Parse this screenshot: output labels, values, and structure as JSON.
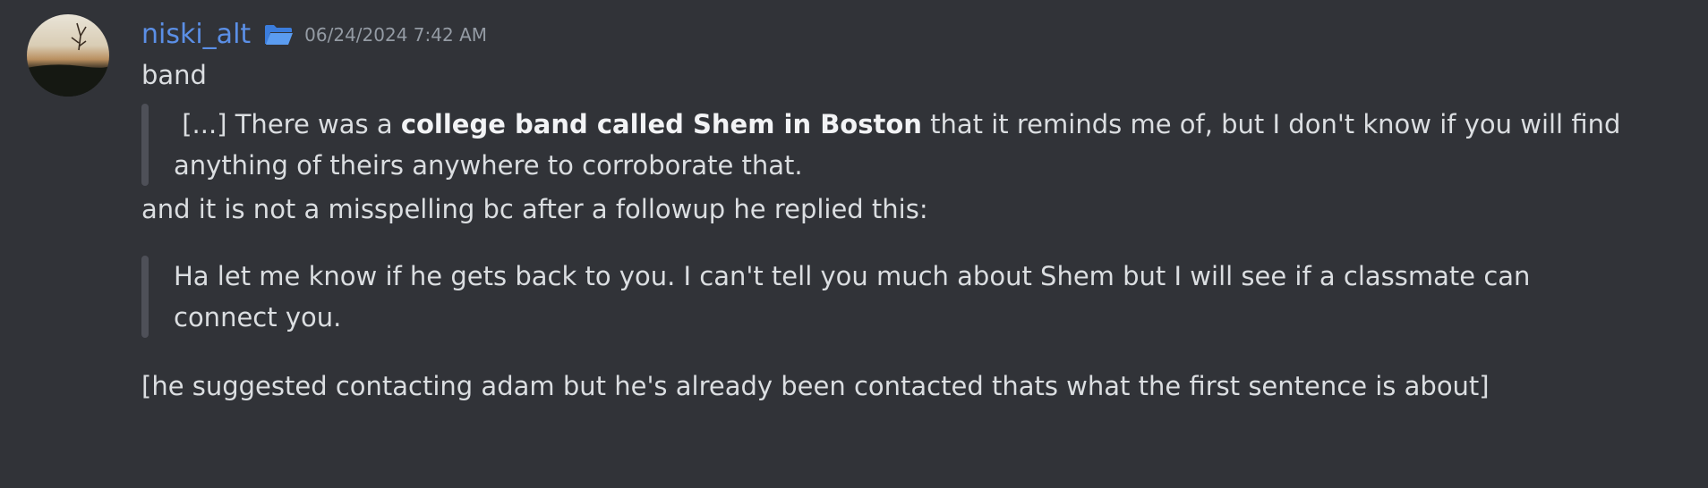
{
  "message": {
    "author": "niski_alt",
    "timestamp": "06/24/2024 7:42 AM",
    "icons": {
      "folder": "folder-icon",
      "avatar": "avatar-sunset-image"
    },
    "colors": {
      "username": "#5b8fe6",
      "text": "#dbdee1",
      "muted": "#949ba4",
      "background": "#313338",
      "quote_bar": "#4e5058"
    },
    "lines": {
      "first": "band",
      "quote1": {
        "line1_pre": "[...] There was a ",
        "line1_bold": "college band called Shem in Boston",
        "line1_post": " that it reminds me of, but I don't know if you will find",
        "line2": "anything of theirs anywhere to corroborate that."
      },
      "middle": "and it is not a misspelling bc after a followup he replied this:",
      "quote2": {
        "line1": "Ha let me know if he gets back to you. I can't tell you much about Shem but I will see if a classmate can",
        "line2": "connect you."
      },
      "last": "[he suggested contacting adam but he's already been contacted thats what the first sentence is about]"
    }
  }
}
